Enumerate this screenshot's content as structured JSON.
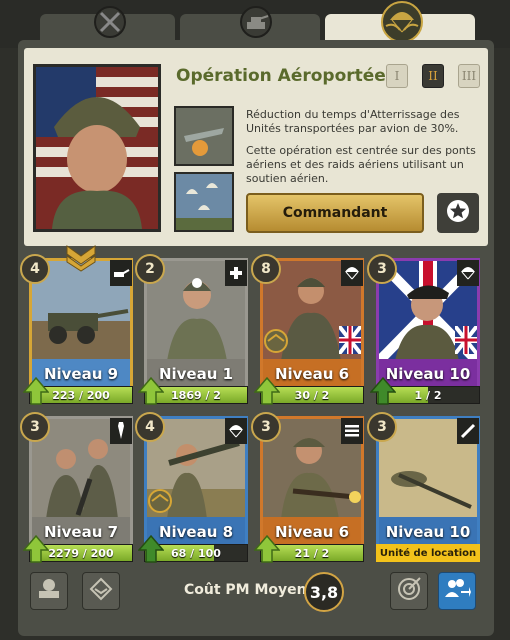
{
  "operation": {
    "name": "Opération Aéroportée",
    "levels": [
      "I",
      "II",
      "III"
    ],
    "active_level": "II",
    "desc1": "Réduction du temps d'Atterrissage des Unités transportées par avion de 30%.",
    "desc2": "Cette opération est centrée sur des ponts aériens et des raids aériens utilisant un soutien aérien.",
    "commander_label": "Commandant"
  },
  "cards": [
    {
      "badge": "4",
      "level": "Niveau 9",
      "progress": "223 / 200",
      "fill": 1.0,
      "rarity": "gold"
    },
    {
      "badge": "2",
      "level": "Niveau 1",
      "progress": "1869 / 2",
      "fill": 1.0,
      "rarity": "grey"
    },
    {
      "badge": "8",
      "level": "Niveau 6",
      "progress": "30 / 2",
      "fill": 1.0,
      "rarity": "orange"
    },
    {
      "badge": "3",
      "level": "Niveau 10",
      "progress": "1 / 2",
      "fill": 0.5,
      "rarity": "purple"
    },
    {
      "badge": "3",
      "level": "Niveau 7",
      "progress": "2279 / 200",
      "fill": 1.0,
      "rarity": "grey"
    },
    {
      "badge": "4",
      "level": "Niveau 8",
      "progress": "68 / 100",
      "fill": 0.68,
      "rarity": "blue"
    },
    {
      "badge": "3",
      "level": "Niveau 6",
      "progress": "21 / 2",
      "fill": 1.0,
      "rarity": "orange"
    },
    {
      "badge": "3",
      "level": "Niveau 10",
      "rental": "Unité de location",
      "rarity": "blue"
    }
  ],
  "bottom": {
    "cost_label": "Coût PM Moyen",
    "cost_value": "3,8"
  },
  "colors": {
    "panel": "#4c4e46",
    "header_bg": "#e8e5d4",
    "title_green": "#5a6a2c",
    "gold_button": "#d4ab48",
    "progress_green": "#9cc83f",
    "rental_yellow": "#f3c21a"
  }
}
